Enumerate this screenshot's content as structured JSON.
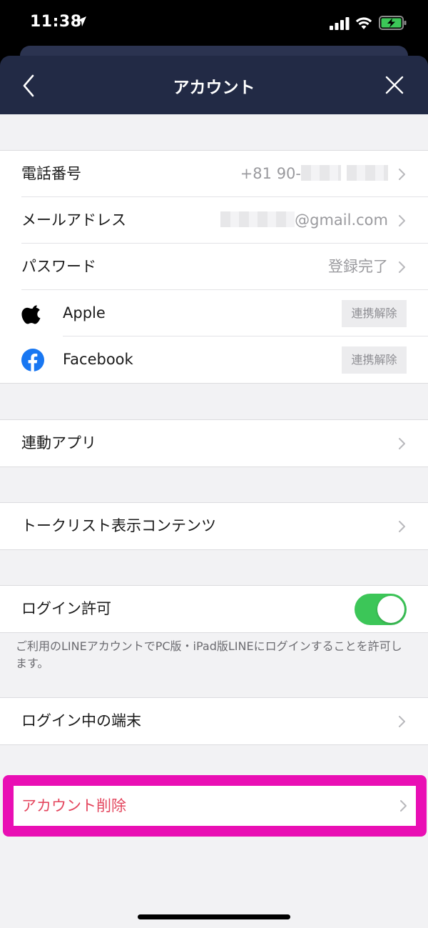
{
  "status_bar": {
    "time": "11:38"
  },
  "header": {
    "title": "アカウント"
  },
  "account_group": [
    {
      "label": "電話番号",
      "value_visible": "+81 90-",
      "value_note": "blurred"
    },
    {
      "label": "メールアドレス",
      "value_visible": "@gmail.com",
      "value_note": "blurred prefix"
    },
    {
      "label": "パスワード",
      "value": "登録完了"
    },
    {
      "label": "Apple",
      "icon": "apple-icon",
      "action": "連携解除"
    },
    {
      "label": "Facebook",
      "icon": "facebook-icon",
      "action": "連携解除"
    }
  ],
  "linked_apps": {
    "label": "連動アプリ"
  },
  "talk_list": {
    "label": "トークリスト表示コンテンツ"
  },
  "login_allow": {
    "label": "ログイン許可",
    "enabled": true,
    "description": "ご利用のLINEアカウントでPC版・iPad版LINEにログインすることを許可します。"
  },
  "logged_in_devices": {
    "label": "ログイン中の端末"
  },
  "delete_account": {
    "label": "アカウント削除"
  },
  "colors": {
    "header_bg": "#222a45",
    "toggle_on": "#3cc658",
    "delete_text": "#e4465e",
    "highlight_border": "#e90fb4",
    "facebook_blue": "#1877f2"
  }
}
